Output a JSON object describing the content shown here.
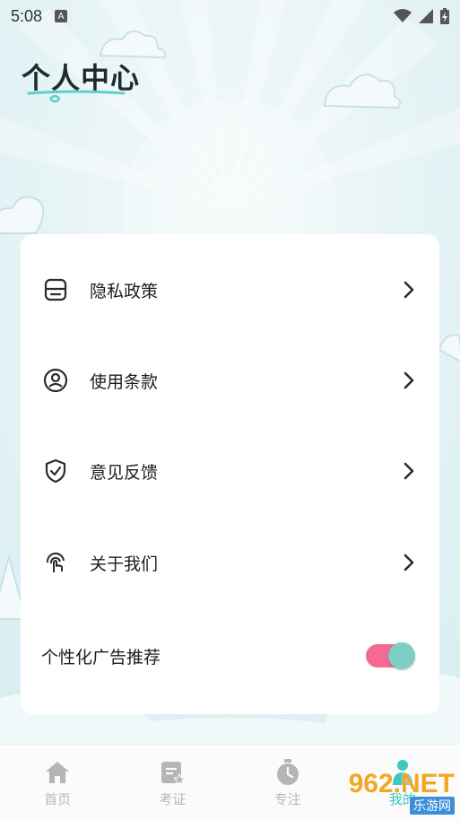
{
  "status_bar": {
    "time": "5:08",
    "notification_icon": "a-badge-icon",
    "wifi_icon": "wifi-icon",
    "signal_icon": "cell-signal-icon",
    "battery_icon": "battery-charging-icon"
  },
  "header": {
    "title": "个人中心"
  },
  "menu": {
    "items": [
      {
        "label": "隐私政策",
        "icon": "document-box-icon"
      },
      {
        "label": "使用条款",
        "icon": "user-circle-icon"
      },
      {
        "label": "意见反馈",
        "icon": "shield-check-icon"
      },
      {
        "label": "关于我们",
        "icon": "touch-hand-icon"
      }
    ],
    "toggle": {
      "label": "个性化广告推荐",
      "on": true
    }
  },
  "tabs": [
    {
      "label": "首页",
      "icon": "home-icon",
      "active": false
    },
    {
      "label": "考证",
      "icon": "certificate-icon",
      "active": false
    },
    {
      "label": "专注",
      "icon": "timer-icon",
      "active": false
    },
    {
      "label": "我的",
      "icon": "person-icon",
      "active": true
    }
  ],
  "watermark": {
    "logo_text": "962.NET",
    "site_text": "乐游网"
  },
  "colors": {
    "accent_teal": "#7fcec6",
    "toggle_pink": "#f46a93",
    "background": "#eaf4f6"
  }
}
